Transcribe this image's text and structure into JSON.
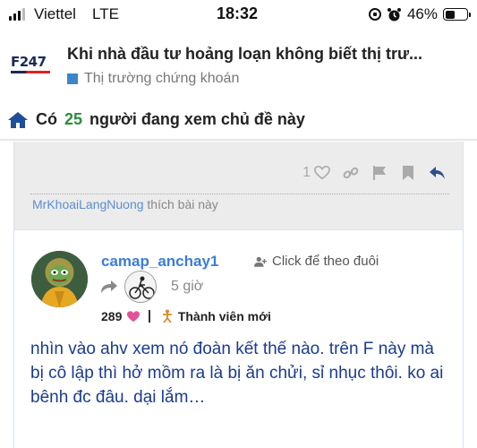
{
  "status_bar": {
    "carrier": "Viettel",
    "network": "LTE",
    "time": "18:32",
    "battery_percent": "46%",
    "battery_level": 0.46,
    "signal_bars": 3,
    "icons": [
      "signal-icon",
      "orientation-lock-icon",
      "alarm-icon",
      "battery-icon"
    ]
  },
  "header": {
    "logo_text": "F247",
    "title": "Khi nhà đầu tư hoảng loạn không biết thị trư...",
    "category": "Thị trường chứng khoán",
    "category_color": "#3a86c8"
  },
  "viewers": {
    "prefix": "Có",
    "count": "25",
    "suffix": "người đang xem chủ đề này",
    "icon": "home-icon"
  },
  "previous_post": {
    "like_count": "1",
    "action_icons": [
      "heart-icon",
      "link-icon",
      "flag-icon",
      "bookmark-icon",
      "reply-icon"
    ],
    "liked_by_user": "MrKhoaiLangNuong",
    "liked_by_text": "thích bài này"
  },
  "post": {
    "username": "camap_anchay1",
    "follow_label": "Click để theo đuôi",
    "time_ago": "5 giờ",
    "likes_received": "289",
    "badge": "Thành viên mới",
    "body": "nhìn vào ahv xem nó đoàn kết thế nào. trên F này mà bị cô lập thì hở mồm ra là bị ăn chửi, sỉ nhục thôi. ko ai bênh đc đâu. dại lắm…"
  },
  "colors": {
    "accent_blue": "#3b7dd8",
    "body_text": "#1a3c8e",
    "viewer_count_green": "#2e8b3a",
    "heart_pink": "#e0559a",
    "badge_orange": "#d98a2b"
  }
}
